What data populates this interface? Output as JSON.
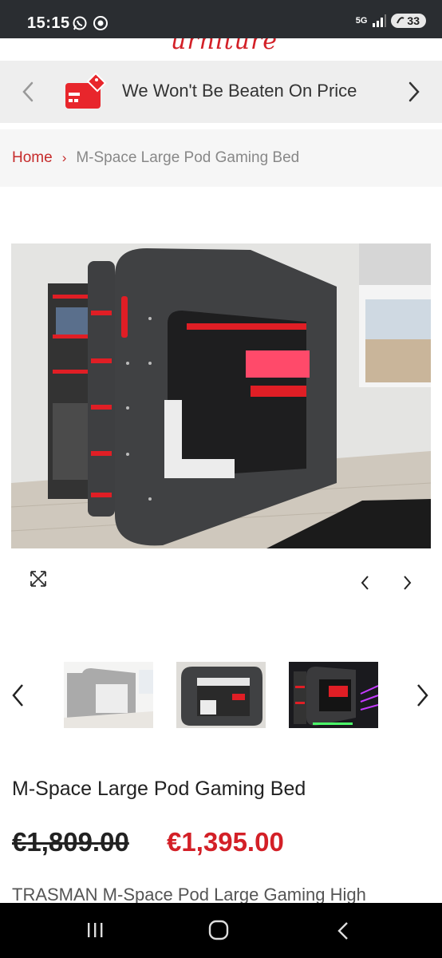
{
  "status_bar": {
    "time": "15:15",
    "network": "5G",
    "battery": "33"
  },
  "site": {
    "logo_fragment": "urniture"
  },
  "promo": {
    "text": "We Won't Be Beaten On Price"
  },
  "breadcrumb": {
    "home": "Home",
    "separator": "›",
    "current": "M-Space Large Pod Gaming Bed"
  },
  "product": {
    "title": "M-Space Large Pod Gaming Bed",
    "old_price": "€1,809.00",
    "new_price": "€1,395.00",
    "description": "TRASMAN M-Space Pod Large Gaming High"
  },
  "colors": {
    "accent_red": "#d32027",
    "breadcrumb_red": "#c62b2b",
    "promo_bg": "#eeeeee",
    "status_bar_bg": "#2a2d31"
  },
  "icons": {
    "promo": "credit-card-tag-icon",
    "expand": "expand-arrows-icon",
    "whatsapp": "whatsapp-icon",
    "chrome": "chrome-icon"
  }
}
